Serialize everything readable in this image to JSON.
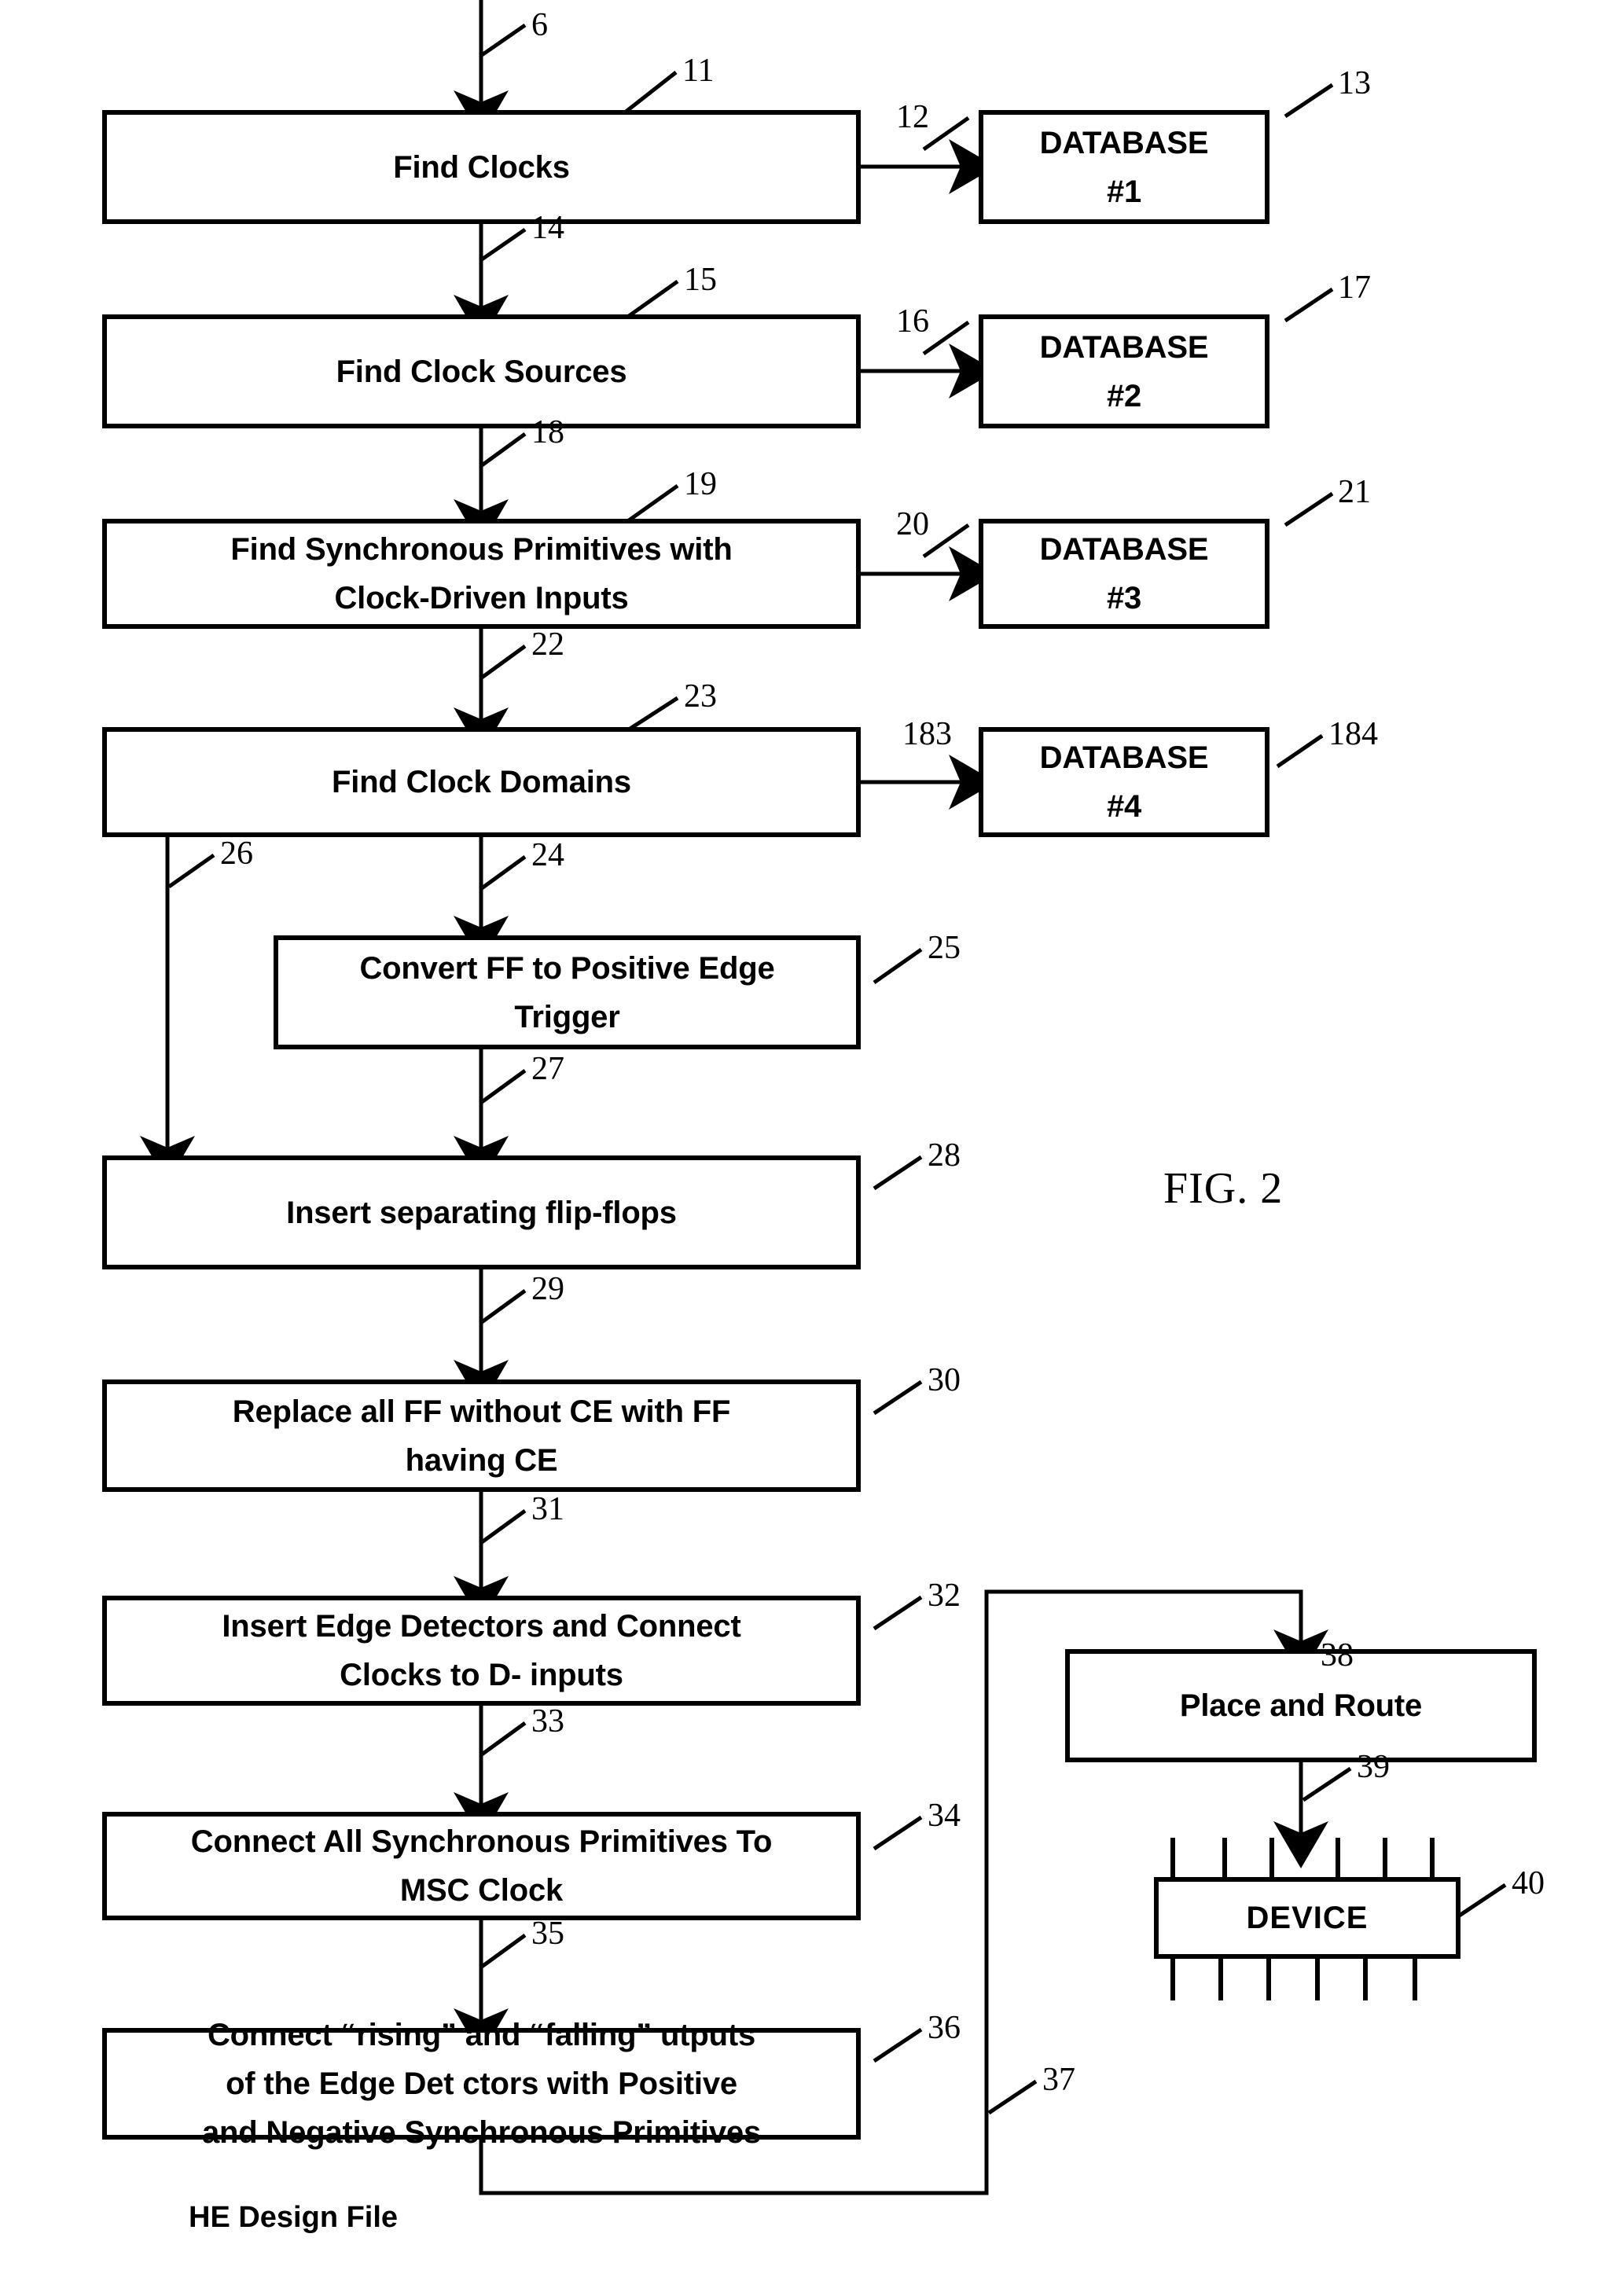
{
  "figure": {
    "caption": "FIG. 2",
    "bottom_note": "HE Design File"
  },
  "process_blocks": [
    {
      "id": "find-clocks",
      "label": "Find Clocks",
      "ref": "11"
    },
    {
      "id": "find-clock-sources",
      "label": "Find Clock Sources",
      "ref": "15"
    },
    {
      "id": "find-sync-primitives",
      "label": "Find Synchronous Primitives with\nClock-Driven Inputs",
      "ref": "19"
    },
    {
      "id": "find-clock-domains",
      "label": "Find Clock Domains",
      "ref": "23"
    },
    {
      "id": "convert-ff",
      "label": "Convert FF to Positive Edge\nTrigger",
      "ref": "25"
    },
    {
      "id": "insert-separating-ff",
      "label": "Insert separating flip-flops",
      "ref": "28"
    },
    {
      "id": "replace-ff-ce",
      "label": "Replace all FF without CE with FF\nhaving CE",
      "ref": "30"
    },
    {
      "id": "insert-edge-detectors",
      "label": "Insert Edge Detectors and Connect\nClocks to D- inputs",
      "ref": "32"
    },
    {
      "id": "connect-msc-clock",
      "label": "Connect All Synchronous Primitives To\nMSC Clock",
      "ref": "34"
    },
    {
      "id": "connect-rising-falling",
      "label": "Connect “rising” and “falling”    utputs\nof the Edge Det  ctors with Positive\nand Negative Synchronous Primitives",
      "ref": "36"
    },
    {
      "id": "place-and-route",
      "label": "Place and Route",
      "ref": "38"
    },
    {
      "id": "device",
      "label": "DEVICE",
      "ref": "40"
    }
  ],
  "database_blocks": [
    {
      "id": "database-1",
      "label": "DATABASE\n#1",
      "ref": "13",
      "arrow_ref": "12"
    },
    {
      "id": "database-2",
      "label": "DATABASE\n#2",
      "ref": "17",
      "arrow_ref": "16"
    },
    {
      "id": "database-3",
      "label": "DATABASE\n#3",
      "ref": "21",
      "arrow_ref": "20"
    },
    {
      "id": "database-4",
      "label": "DATABASE\n#4",
      "ref": "184",
      "arrow_ref": "183"
    }
  ],
  "flow_refs": [
    {
      "id": "ref-6",
      "label": "6"
    },
    {
      "id": "ref-14",
      "label": "14"
    },
    {
      "id": "ref-18",
      "label": "18"
    },
    {
      "id": "ref-22",
      "label": "22"
    },
    {
      "id": "ref-24",
      "label": "24"
    },
    {
      "id": "ref-26",
      "label": "26"
    },
    {
      "id": "ref-27",
      "label": "27"
    },
    {
      "id": "ref-29",
      "label": "29"
    },
    {
      "id": "ref-31",
      "label": "31"
    },
    {
      "id": "ref-33",
      "label": "33"
    },
    {
      "id": "ref-35",
      "label": "35"
    },
    {
      "id": "ref-37",
      "label": "37"
    },
    {
      "id": "ref-39",
      "label": "39"
    }
  ],
  "colors": {
    "ink": "#000000",
    "paper": "#ffffff"
  }
}
